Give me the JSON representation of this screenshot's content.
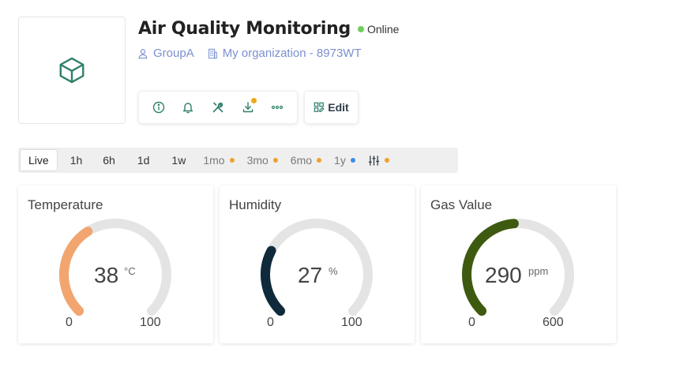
{
  "device": {
    "title": "Air Quality Monitoring",
    "status": "Online",
    "status_color": "#6fcf5e",
    "icon": "cube-icon",
    "group": "GroupA",
    "organization": "My organization - 8973WT",
    "link_color": "#7b8fcf",
    "accent_color": "#2f7f6a"
  },
  "actions": {
    "items": [
      "info-icon",
      "bell-icon",
      "tools-icon",
      "download-icon",
      "more-icon"
    ],
    "download_badge_color": "#f0a81a",
    "edit_label": "Edit"
  },
  "time_ranges": [
    {
      "label": "Live",
      "active": true
    },
    {
      "label": "1h"
    },
    {
      "label": "6h"
    },
    {
      "label": "1d"
    },
    {
      "label": "1w"
    },
    {
      "label": "1mo",
      "dot": "#f0a030"
    },
    {
      "label": "3mo",
      "dot": "#f0a030"
    },
    {
      "label": "6mo",
      "dot": "#f0a030"
    },
    {
      "label": "1y",
      "dot": "#3a8ee6"
    },
    {
      "icon": "sliders-icon",
      "dot": "#f0a030"
    }
  ],
  "widgets": [
    {
      "title": "Temperature",
      "value": "38",
      "unit": "°C",
      "min": "0",
      "max": "100",
      "fraction": 0.38,
      "color": "#f2a56f"
    },
    {
      "title": "Humidity",
      "value": "27",
      "unit": "%",
      "min": "0",
      "max": "100",
      "fraction": 0.27,
      "color": "#0f2a3a"
    },
    {
      "title": "Gas Value",
      "value": "290",
      "unit": "ppm",
      "min": "0",
      "max": "600",
      "fraction": 0.4833,
      "color": "#3e5a10"
    }
  ]
}
